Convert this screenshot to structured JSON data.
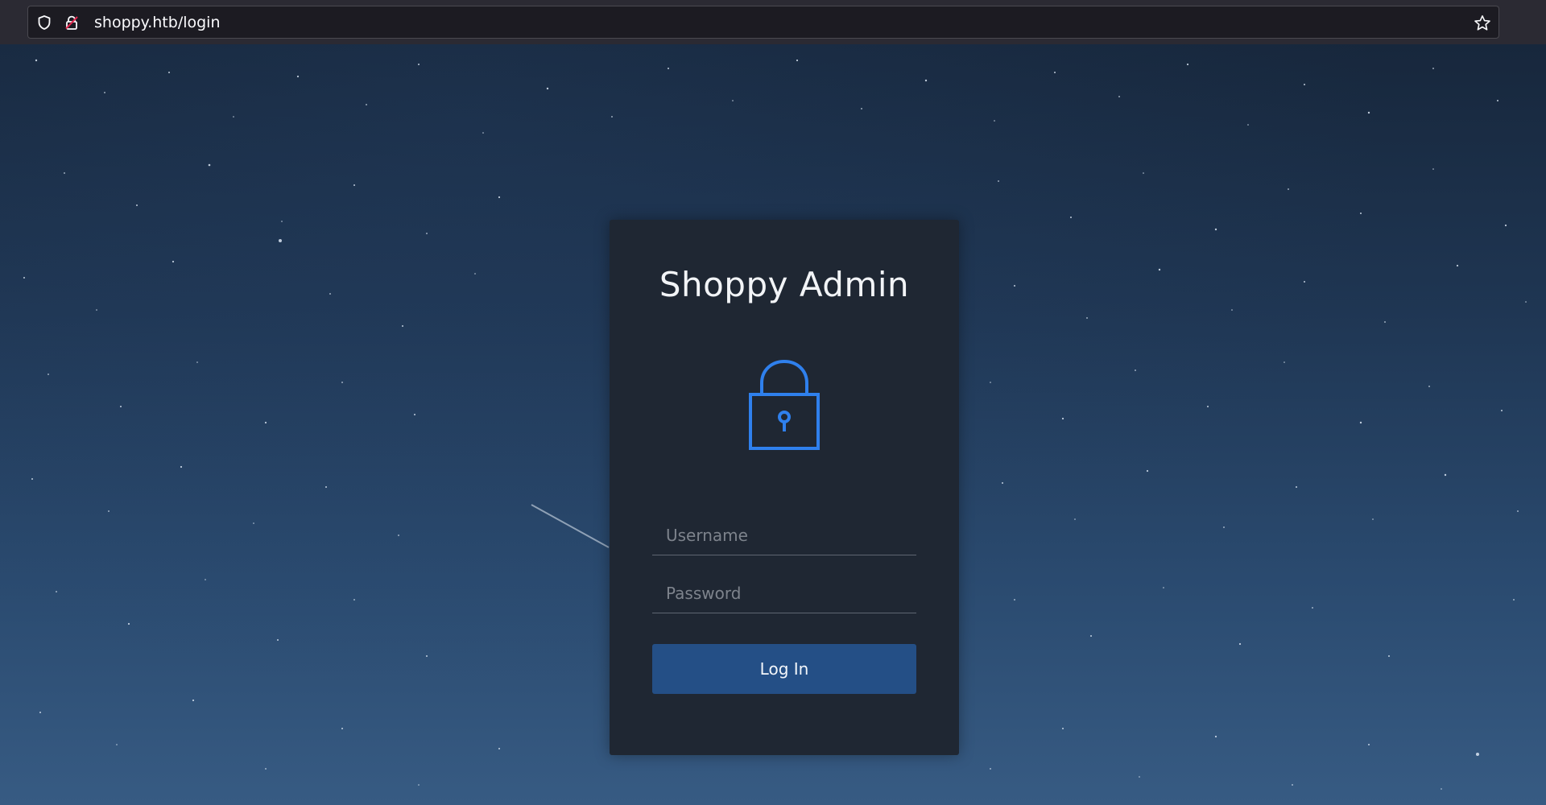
{
  "browser": {
    "url": "shoppy.htb/login",
    "icons": [
      "shield-icon",
      "lock-insecure-icon",
      "star-icon"
    ]
  },
  "login": {
    "title": "Shoppy Admin",
    "icon": "padlock-icon",
    "username_placeholder": "Username",
    "password_placeholder": "Password",
    "submit_label": "Log In"
  },
  "colors": {
    "accent": "#2f80ed",
    "button": "#244f86",
    "card": "#1f2733",
    "sky_top": "#17273c",
    "sky_bottom": "#375b83"
  }
}
